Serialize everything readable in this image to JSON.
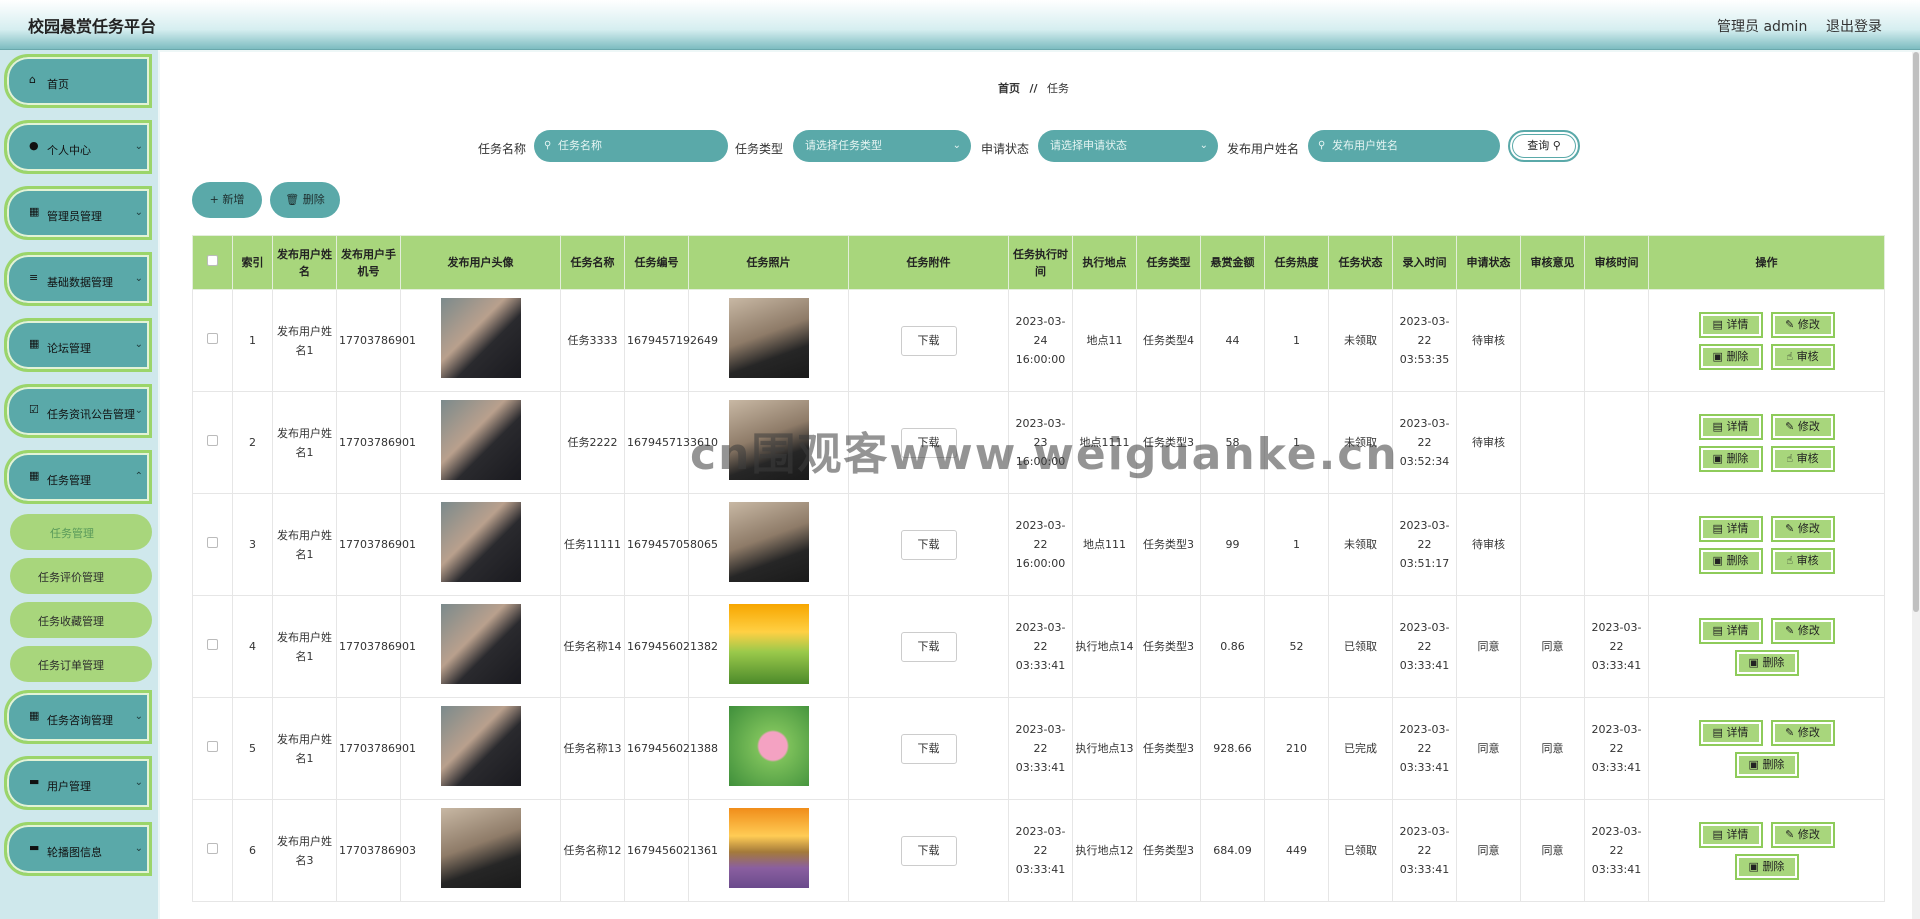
{
  "app": {
    "title": "校园悬赏任务平台",
    "admin_label": "管理员 admin",
    "logout_label": "退出登录"
  },
  "sidebar": {
    "items": [
      {
        "label": "首页",
        "icon": "home-icon",
        "chevron": false
      },
      {
        "label": "个人中心",
        "icon": "user-icon",
        "chevron": true
      },
      {
        "label": "管理员管理",
        "icon": "grid-icon",
        "chevron": true
      },
      {
        "label": "基础数据管理",
        "icon": "list-icon",
        "chevron": true
      },
      {
        "label": "论坛管理",
        "icon": "grid-icon",
        "chevron": true
      },
      {
        "label": "任务资讯公告管理",
        "icon": "check-icon",
        "chevron": true
      },
      {
        "label": "任务管理",
        "icon": "grid-icon",
        "chevron": true
      },
      {
        "label": "任务咨询管理",
        "icon": "apps-icon",
        "chevron": true
      },
      {
        "label": "用户管理",
        "icon": "monitor-icon",
        "chevron": true
      },
      {
        "label": "轮播图信息",
        "icon": "monitor-icon",
        "chevron": true
      }
    ],
    "sub_items": [
      "任务管理",
      "任务评价管理",
      "任务收藏管理",
      "任务订单管理"
    ]
  },
  "breadcrumb": {
    "home": "首页",
    "separator": "//",
    "current": "任务"
  },
  "search": {
    "name_label": "任务名称",
    "name_placeholder": "任务名称",
    "type_label": "任务类型",
    "type_placeholder": "请选择任务类型",
    "apply_label": "申请状态",
    "apply_placeholder": "请选择申请状态",
    "user_label": "发布用户姓名",
    "user_placeholder": "发布用户姓名",
    "query_label": "查询"
  },
  "actions": {
    "add_label": "+ 新增",
    "delete_label": "删除"
  },
  "table": {
    "headers": [
      "索引",
      "发布用户姓名",
      "发布用户手机号",
      "发布用户头像",
      "任务名称",
      "任务编号",
      "任务照片",
      "任务附件",
      "任务执行时间",
      "执行地点",
      "任务类型",
      "悬赏金额",
      "任务热度",
      "任务状态",
      "录入时间",
      "申请状态",
      "审核意见",
      "审核时间",
      "操作"
    ],
    "download_label": "下载",
    "op_labels": {
      "detail": "详情",
      "edit": "修改",
      "delete": "删除",
      "review": "审核"
    },
    "rows": [
      {
        "idx": "1",
        "user": "发布用户姓名1",
        "phone": "17703786901",
        "avatar": "man-photo",
        "name": "任务3333",
        "code": "1679457192649",
        "photo": "man-painting-photo",
        "exec_time": "2023-03-24 16:00:00",
        "place": "地点11",
        "type": "任务类型4",
        "amount": "44",
        "heat": "1",
        "status": "未领取",
        "entry": "2023-03-22 03:53:35",
        "apply": "待审核",
        "opinion": "",
        "review_time": "",
        "review": true
      },
      {
        "idx": "2",
        "user": "发布用户姓名1",
        "phone": "17703786901",
        "avatar": "man-photo",
        "name": "任务2222",
        "code": "1679457133610",
        "photo": "man-painting-photo",
        "exec_time": "2023-03-23 16:00:00",
        "place": "地点1111",
        "type": "任务类型3",
        "amount": "58",
        "heat": "1",
        "status": "未领取",
        "entry": "2023-03-22 03:52:34",
        "apply": "待审核",
        "opinion": "",
        "review_time": "",
        "review": true
      },
      {
        "idx": "3",
        "user": "发布用户姓名1",
        "phone": "17703786901",
        "avatar": "man-photo",
        "name": "任务11111",
        "code": "1679457058065",
        "photo": "man-painting-photo",
        "exec_time": "2023-03-22 16:00:00",
        "place": "地点111",
        "type": "任务类型3",
        "amount": "99",
        "heat": "1",
        "status": "未领取",
        "entry": "2023-03-22 03:51:17",
        "apply": "待审核",
        "opinion": "",
        "review_time": "",
        "review": true
      },
      {
        "idx": "4",
        "user": "发布用户姓名1",
        "phone": "17703786901",
        "avatar": "man-photo",
        "name": "任务名称14",
        "code": "1679456021382",
        "photo": "sunrise-photo",
        "exec_time": "2023-03-22 03:33:41",
        "place": "执行地点14",
        "type": "任务类型3",
        "amount": "0.86",
        "heat": "52",
        "status": "已领取",
        "entry": "2023-03-22 03:33:41",
        "apply": "同意",
        "opinion": "同意",
        "review_time": "2023-03-22 03:33:41",
        "review": false
      },
      {
        "idx": "5",
        "user": "发布用户姓名1",
        "phone": "17703786901",
        "avatar": "man-photo",
        "name": "任务名称13",
        "code": "1679456021388",
        "photo": "lotus-photo",
        "exec_time": "2023-03-22 03:33:41",
        "place": "执行地点13",
        "type": "任务类型3",
        "amount": "928.66",
        "heat": "210",
        "status": "已完成",
        "entry": "2023-03-22 03:33:41",
        "apply": "同意",
        "opinion": "同意",
        "review_time": "2023-03-22 03:33:41",
        "review": false
      },
      {
        "idx": "6",
        "user": "发布用户姓名3",
        "phone": "17703786903",
        "avatar": "man-painting-photo",
        "name": "任务名称12",
        "code": "1679456021361",
        "photo": "field-photo",
        "exec_time": "2023-03-22 03:33:41",
        "place": "执行地点12",
        "type": "任务类型3",
        "amount": "684.09",
        "heat": "449",
        "status": "已领取",
        "entry": "2023-03-22 03:33:41",
        "apply": "同意",
        "opinion": "同意",
        "review_time": "2023-03-22 03:33:41",
        "review": false
      }
    ]
  },
  "watermark": "cn围观客www.weiguanke.cn",
  "colors": {
    "accent": "#5aa9a9",
    "green": "#a8d67c",
    "border_green": "#8ecb5a"
  }
}
